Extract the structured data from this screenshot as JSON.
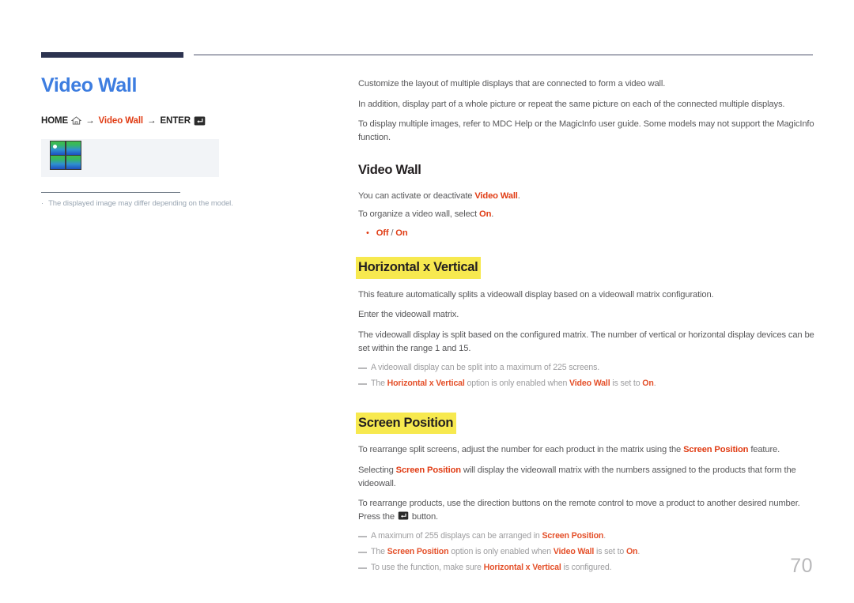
{
  "page": {
    "number": "70",
    "title": "Video Wall"
  },
  "breadcrumb": {
    "home_label": "HOME",
    "home_icon": "home-icon",
    "arrow": "→",
    "middle_label": "Video Wall",
    "enter_label": "ENTER",
    "enter_icon": "enter-key-icon"
  },
  "illustration": {
    "icon_name": "video-wall-2x2-icon",
    "note_bullet": "·",
    "note": "The displayed image may differ depending on the model."
  },
  "intro": {
    "p1": "Customize the layout of multiple displays that are connected to form a video wall.",
    "p2": "In addition, display part of a whole picture or repeat the same picture on each of the connected multiple displays.",
    "p3": "To display multiple images, refer to MDC Help or the MagicInfo user guide. Some models may not support the MagicInfo function."
  },
  "section_video_wall": {
    "title": "Video Wall",
    "line1_a": "You can activate or deactivate ",
    "line1_b": "Video Wall",
    "line1_c": ".",
    "line2_a": "To organize a video wall, select ",
    "line2_b": "On",
    "line2_c": ".",
    "option_off": "Off",
    "option_sep": " / ",
    "option_on": "On"
  },
  "section_horizontal_x_vertical": {
    "title": "Horizontal x Vertical",
    "p1": "This feature automatically splits a videowall display based on a videowall matrix configuration.",
    "p2": "Enter the videowall matrix.",
    "p3": "The videowall display is split based on the configured matrix. The number of vertical or horizontal display devices can be set within the range 1 and 15.",
    "note1": "A videowall display can be split into a maximum of 225 screens.",
    "note2_a": "The ",
    "note2_b": "Horizontal x Vertical",
    "note2_c": " option is only enabled when ",
    "note2_d": "Video Wall",
    "note2_e": " is set to ",
    "note2_f": "On",
    "note2_g": "."
  },
  "section_screen_position": {
    "title": "Screen Position",
    "p1_a": "To rearrange split screens, adjust the number for each product in the matrix using the ",
    "p1_b": "Screen Position",
    "p1_c": " feature.",
    "p2_a": "Selecting ",
    "p2_b": "Screen Position",
    "p2_c": " will display the videowall matrix with the numbers assigned to the products that form the videowall.",
    "p3_a": "To rearrange products, use the direction buttons on the remote control to move a product to another desired number. Press the ",
    "p3_b": " button.",
    "note1_a": "A maximum of 255 displays can be arranged in ",
    "note1_b": "Screen Position",
    "note1_c": ".",
    "note2_a": "The ",
    "note2_b": "Screen Position",
    "note2_c": " option is only enabled when ",
    "note2_d": "Video Wall",
    "note2_e": " is set to ",
    "note2_f": "On",
    "note2_g": ".",
    "note3_a": "To use the function, make sure ",
    "note3_b": "Horizontal x Vertical",
    "note3_c": " is configured."
  },
  "colors": {
    "accent_blue": "#3d7de0",
    "accent_red": "#e03c14",
    "highlight_yellow": "#f7e94f",
    "header_navy": "#2c3350",
    "body_gray": "#58585a"
  }
}
